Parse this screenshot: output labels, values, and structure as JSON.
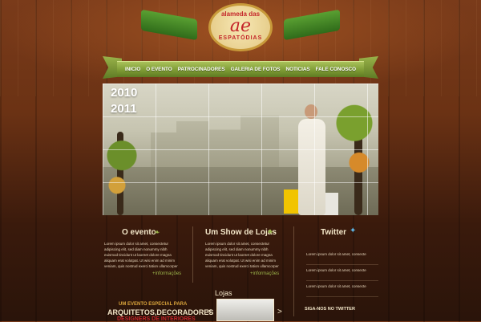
{
  "logo": {
    "top_text": "alameda das",
    "mark": "ae",
    "bottom_text": "ESPATÓDIAS"
  },
  "nav": {
    "items": [
      "INICIO",
      "O EVENTO",
      "PATROCINADORES",
      "GALERIA DE FOTOS",
      "NOTICIAS",
      "FALE CONOSCO"
    ]
  },
  "hero": {
    "years": [
      "2010",
      "2011"
    ]
  },
  "col1": {
    "title": "O evento",
    "text": "Lorem ipsum dolor sit amet, consectetur adipiscing elit, sed diam nonummy nibh euismod tincidunt ut laoreet dolore magna aliquam erat volutpat. Ut wisi enim ad minim veniam, quis nostrud exerci tation ullamcorper suscipit lobortis nisl ut aliquip.",
    "more": "+informações"
  },
  "col2": {
    "title": "Um Show de Lojas",
    "text": "Lorem ipsum dolor sit amet, consectetur adipiscing elit, sed diam nonummy nibh euismod tincidunt ut laoreet dolore magna aliquam erat volutpat. Ut wisi enim ad minim veniam, quis nostrud exerci tation ullamcorper suscipit lobortis nisl ut aliquip.",
    "more": "+informações"
  },
  "twitter": {
    "title": "Twitter",
    "items": [
      "Lorem ipsum dolor sit amet, consecte",
      "Lorem ipsum dolor sit amet, consecte",
      "Lorem ipsum dolor sit amet, consecte"
    ],
    "follow": "SIGA-NOS NO TWITTER"
  },
  "lojas": {
    "title": "Lojas",
    "prev": "<",
    "next": ">"
  },
  "promo": {
    "kicker": "UM EVENTO ESPECIAL PARA",
    "headline": "ARQUITETOS,DECORADORES",
    "headline2": "DESIGNERS DE INTERIORES"
  },
  "colors": {
    "accent_green": "#9ab34a",
    "brand_red": "#c4252a",
    "wood": "#6b3214"
  }
}
